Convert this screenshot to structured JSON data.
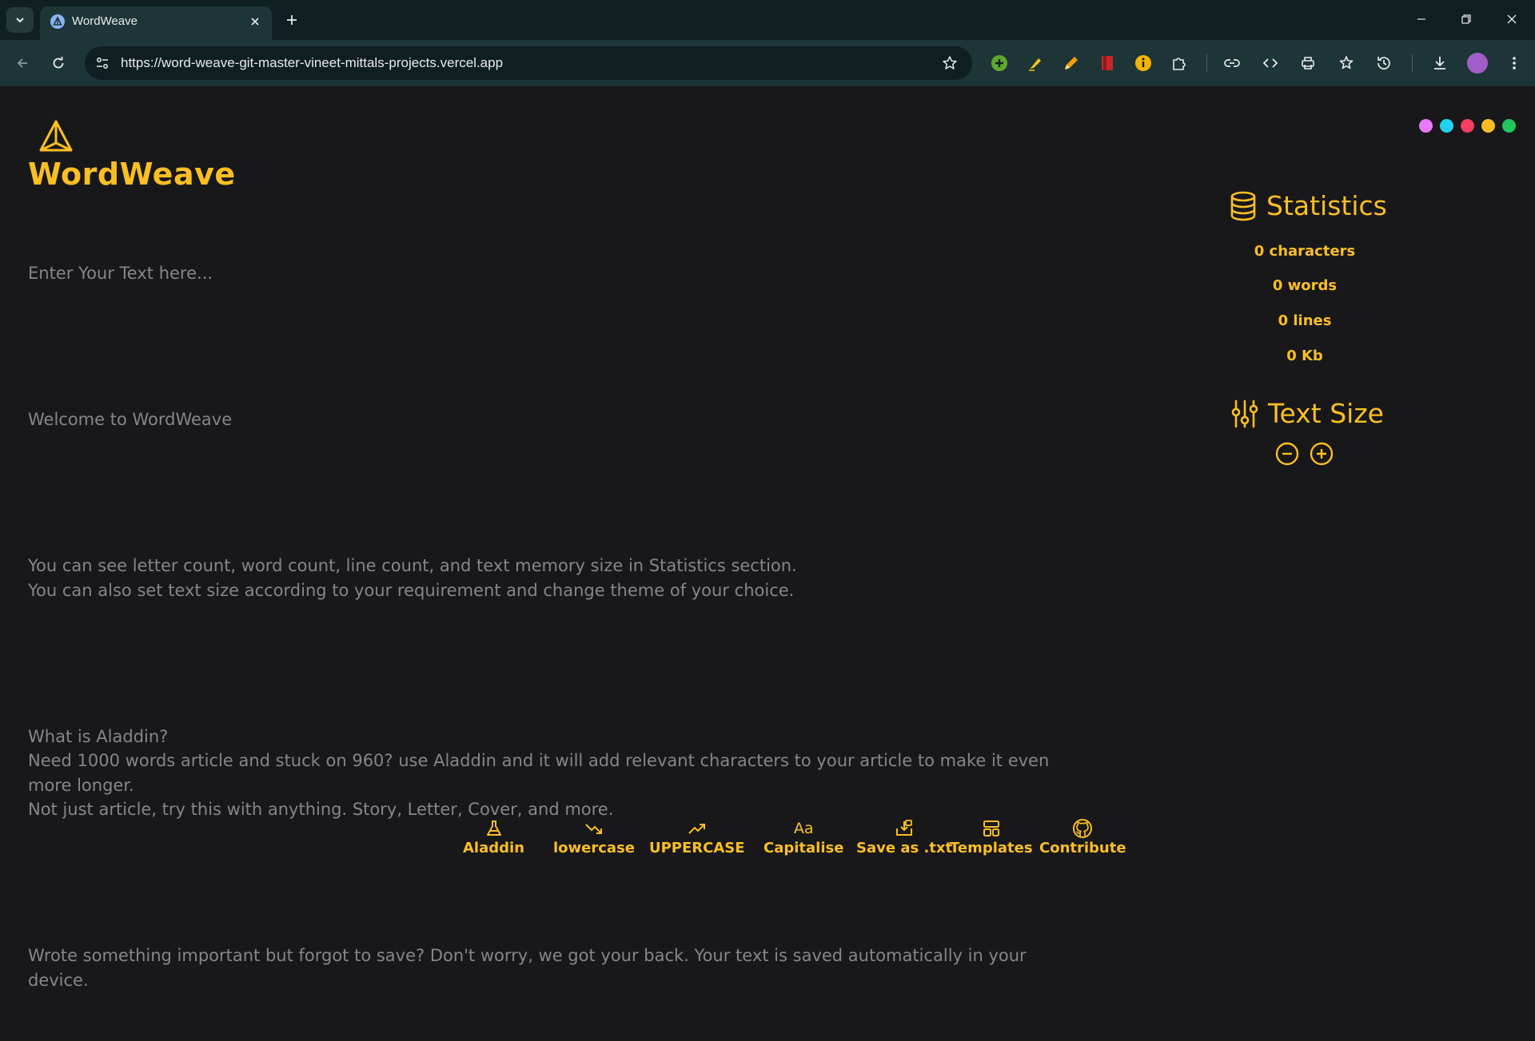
{
  "browser": {
    "tab_title": "WordWeave",
    "url": "https://word-weave-git-master-vineet-mittals-projects.vercel.app",
    "extensions": [
      "plus-circle-icon",
      "highlighter-icon",
      "pencil-icon",
      "bookmark-red-icon",
      "info-icon",
      "puzzle-icon",
      "link-icon",
      "code-icon",
      "printer-icon",
      "star-list-icon",
      "history-icon",
      "download-icon"
    ]
  },
  "app": {
    "brand": "WordWeave",
    "placeholder": "Enter Your Text here...",
    "paragraphs": [
      "Welcome to WordWeave",
      "You can see letter count, word count, line count, and text memory size in Statistics section.\nYou can also set text size according to your requirement and change theme of your choice.",
      "What is Aladdin?\nNeed 1000 words article and stuck on 960? use Aladdin and it will add relevant characters to your article to make it even more longer.\nNot just article, try this with anything. Story, Letter, Cover, and more.",
      "Wrote something important but forgot to save? Don't worry, we got your back. Your text is saved automatically in your device."
    ],
    "theme_colors": [
      "#e879f9",
      "#22d3ee",
      "#f43f5e",
      "#fbbf24",
      "#22c55e"
    ],
    "accent": "#fbbf24",
    "statistics": {
      "title": "Statistics",
      "characters": "0 characters",
      "words": "0 words",
      "lines": "0 lines",
      "size": "0 Kb"
    },
    "text_size": {
      "title": "Text Size"
    },
    "actions": [
      "Aladdin",
      "lowercase",
      "UPPERCASE",
      "Capitalise",
      "Save as .txt",
      "Templates",
      "Contribute"
    ]
  }
}
